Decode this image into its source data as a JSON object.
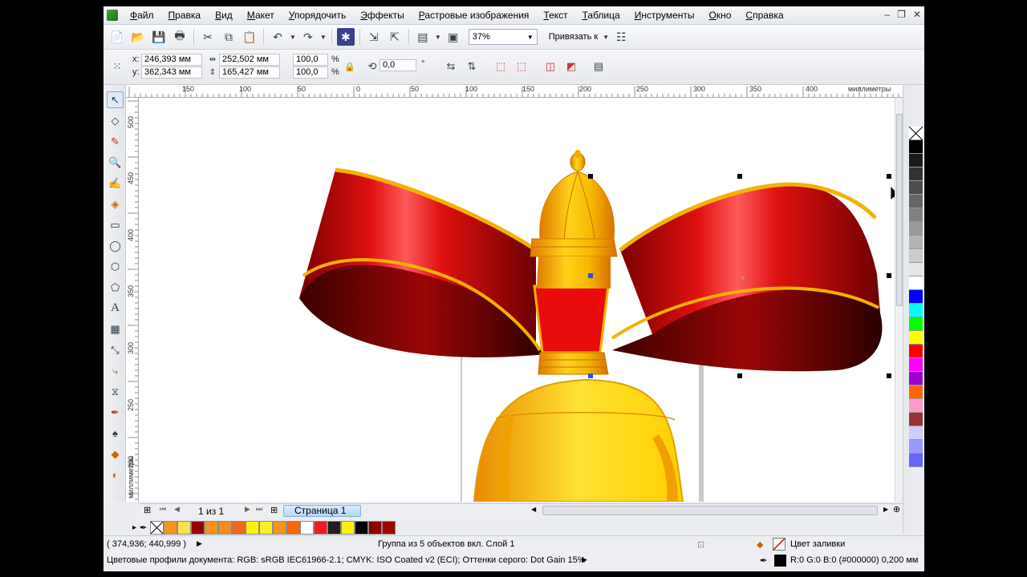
{
  "menu": [
    "Файл",
    "Правка",
    "Вид",
    "Макет",
    "Упорядочить",
    "Эффекты",
    "Растровые изображения",
    "Текст",
    "Таблица",
    "Инструменты",
    "Окно",
    "Справка"
  ],
  "toolbar": {
    "zoom": "37%",
    "snap_label": "Привязать к"
  },
  "properties": {
    "x_label": "x:",
    "x_value": "246,393 мм",
    "y_label": "y:",
    "y_value": "362,343 мм",
    "width_value": "252,502 мм",
    "height_value": "165,427 мм",
    "scale_x": "100,0",
    "scale_y": "100,0",
    "percent": "%",
    "angle": "0,0",
    "degree": "°"
  },
  "ruler": {
    "units": "миллиметры",
    "h_ticks": [
      "150",
      "100",
      "50",
      "0",
      "50",
      "100",
      "150",
      "200",
      "250",
      "300",
      "350",
      "400"
    ],
    "v_ticks": [
      "500",
      "450",
      "400",
      "350",
      "300",
      "250",
      "200"
    ],
    "v_units": "миллиметры"
  },
  "pages": {
    "count": "1 из 1",
    "tab": "Страница 1"
  },
  "palette_colors": [
    "#000000",
    "#1a1a1a",
    "#333333",
    "#4d4d4d",
    "#666666",
    "#808080",
    "#999999",
    "#b3b3b3",
    "#cccccc",
    "#e6e6e6",
    "#ffffff",
    "#0000ff",
    "#00ffff",
    "#00ff00",
    "#ffff00",
    "#ff0000",
    "#ff00ff",
    "#9900cc",
    "#ff6600",
    "#ff99cc",
    "#993333",
    "#ccccff",
    "#9999ff",
    "#6666ff"
  ],
  "document_colors": [
    "#f7941d",
    "#fbe04a",
    "#990000",
    "#f7941d",
    "#f68b1f",
    "#f26522",
    "#fff200",
    "#fcee21",
    "#f7941d",
    "#ff6600",
    "#ffffff",
    "#ed1c24",
    "#231f20",
    "#fff200",
    "#000000",
    "#8b0000",
    "#a00000"
  ],
  "status": {
    "cursor_coords": "( 374,936; 440,999 )",
    "selection_info": "Группа из 5 объектов вкл. Слой 1",
    "fill_label": "Цвет заливки",
    "color_profiles": "Цветовые профили документа: RGB: sRGB IEC61966-2.1; CMYK: ISO Coated v2 (ECI); Оттенки серого: Dot Gain 15%",
    "outline_info": "R:0 G:0 B:0 (#000000)  0,200 мм"
  }
}
